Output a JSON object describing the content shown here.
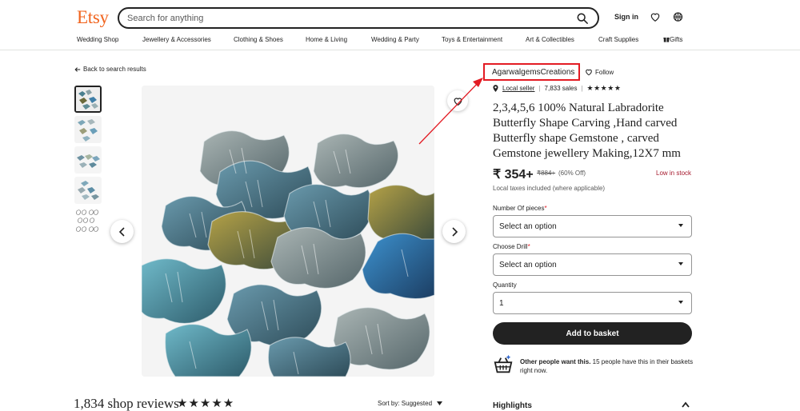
{
  "header": {
    "logo": "Etsy",
    "search_placeholder": "Search for anything",
    "signin": "Sign in"
  },
  "nav": [
    "Wedding Shop",
    "Jewellery & Accessories",
    "Clothing & Shoes",
    "Home & Living",
    "Wedding & Party",
    "Toys & Entertainment",
    "Art & Collectibles",
    "Craft Supplies",
    "Gifts"
  ],
  "listing": {
    "back": "Back to search results",
    "shop_name": "AgarwalgemsCreations",
    "follow": "Follow",
    "local_seller": "Local seller",
    "sales": "7,833 sales",
    "shop_rating_stars": 5,
    "title": "2,3,4,5,6 100% Natural Labradorite Butterfly Shape Carving ,Hand carved Butterfly shape Gemstone , carved Gemstone jewellery Making,12X7 mm",
    "price": "₹ 354+",
    "original_price": "₹884+",
    "discount": "(60% Off)",
    "stock": "Low in stock",
    "tax_note": "Local taxes included (where applicable)",
    "fields": [
      {
        "label": "Number Of pieces",
        "required": "*",
        "value": "Select an option"
      },
      {
        "label": "Choose Drill",
        "required": "*",
        "value": "Select an option"
      },
      {
        "label": "Quantity",
        "required": "",
        "value": "1"
      }
    ],
    "add_to_basket": "Add to basket",
    "others_bold": "Other people want this.",
    "others_text": " 15 people have this in their baskets right now.",
    "highlights": "Highlights"
  },
  "reviews": {
    "title": "1,834 shop reviews",
    "stars": "★★★★★",
    "sort": "Sort by: Suggested"
  },
  "colors": {
    "brand": "#f1641e",
    "annotation": "#e31b23",
    "primary_button": "#222222"
  }
}
